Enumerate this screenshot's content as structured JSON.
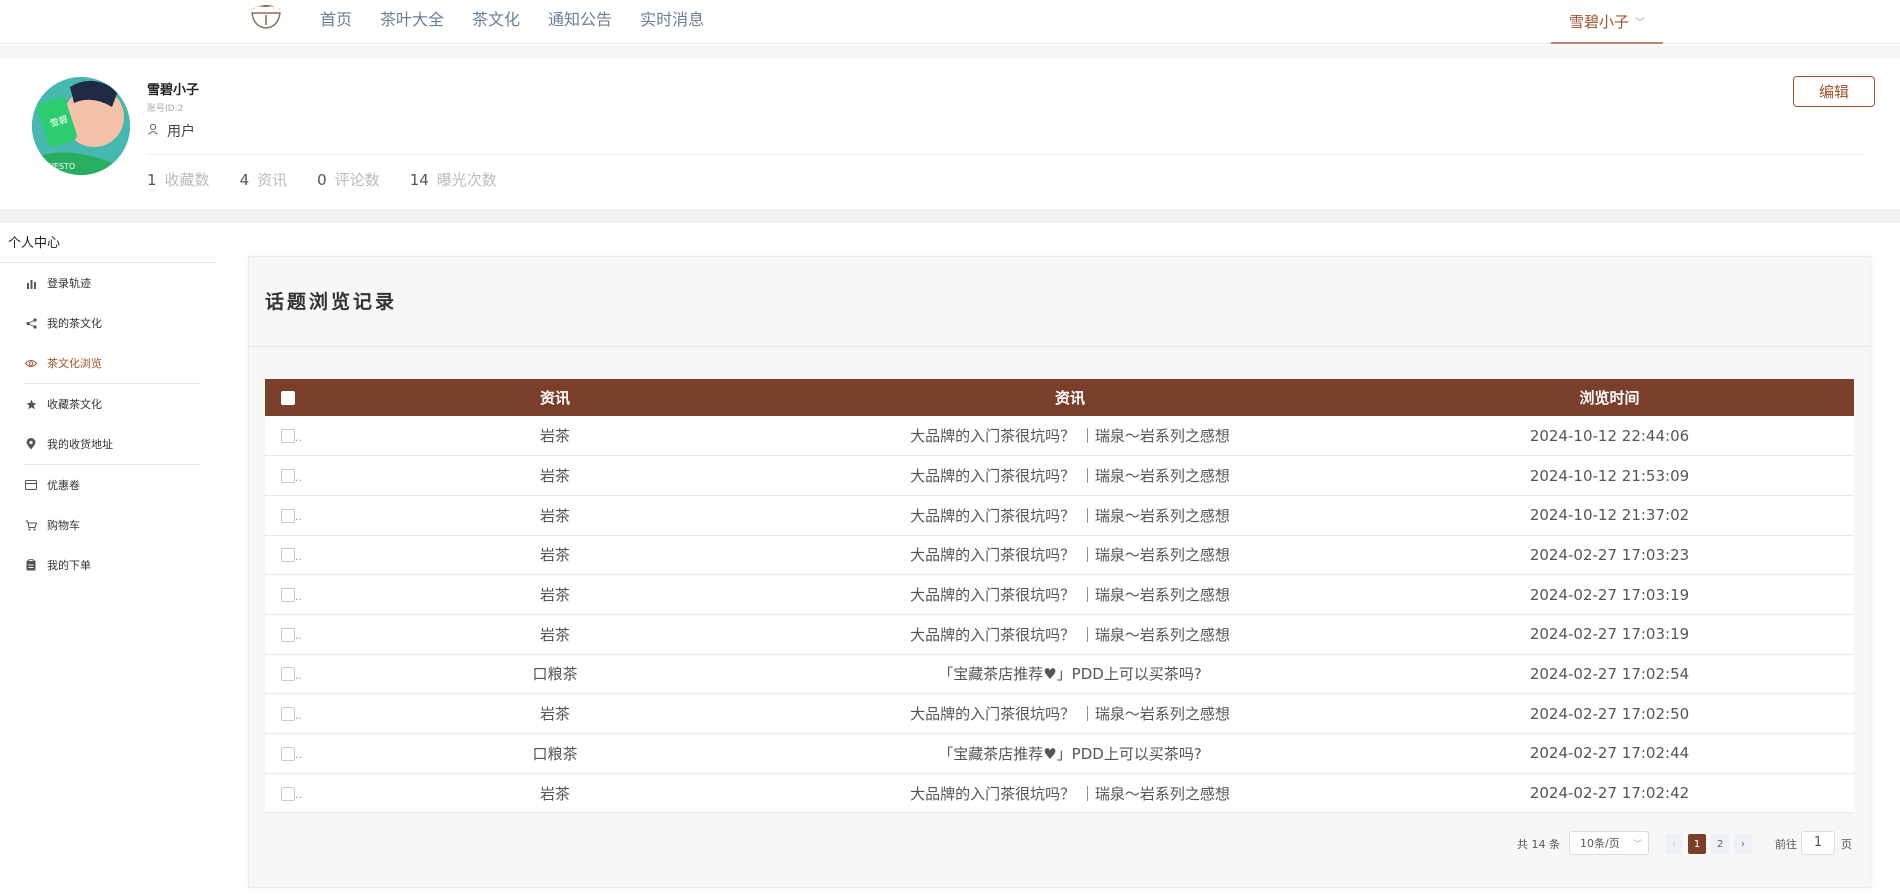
{
  "nav": {
    "items": [
      "首页",
      "茶叶大全",
      "茶文化",
      "通知公告",
      "实时消息"
    ],
    "user": "雪碧小子"
  },
  "profile": {
    "name": "雪碧小子",
    "id_text": "账号ID:2",
    "role": "用户",
    "edit_label": "编辑",
    "stats": [
      {
        "num": "1",
        "label": "收藏数"
      },
      {
        "num": "4",
        "label": "资讯"
      },
      {
        "num": "0",
        "label": "评论数"
      },
      {
        "num": "14",
        "label": "曝光次数"
      }
    ]
  },
  "sidebar": {
    "title": "个人中心",
    "items": [
      {
        "label": "登录轨迹",
        "icon": "bar-chart-icon",
        "active": false
      },
      {
        "label": "我的茶文化",
        "icon": "share-icon",
        "active": false
      },
      {
        "label": "茶文化浏览",
        "icon": "eye-icon",
        "active": true
      },
      {
        "label": "收藏茶文化",
        "icon": "star-icon",
        "active": false
      },
      {
        "label": "我的收货地址",
        "icon": "location-icon",
        "active": false
      },
      {
        "label": "优惠卷",
        "icon": "card-icon",
        "active": false
      },
      {
        "label": "购物车",
        "icon": "cart-icon",
        "active": false
      },
      {
        "label": "我的下单",
        "icon": "clipboard-icon",
        "active": false
      }
    ]
  },
  "card": {
    "title": "话题浏览记录",
    "columns": [
      "资讯",
      "资讯",
      "浏览时间"
    ],
    "rows": [
      {
        "category": "岩茶",
        "title": "大品牌的入门茶很坑吗？ ｜瑞泉～岩系列之感想",
        "time": "2024-10-12 22:44:06"
      },
      {
        "category": "岩茶",
        "title": "大品牌的入门茶很坑吗？ ｜瑞泉～岩系列之感想",
        "time": "2024-10-12 21:53:09"
      },
      {
        "category": "岩茶",
        "title": "大品牌的入门茶很坑吗？ ｜瑞泉～岩系列之感想",
        "time": "2024-10-12 21:37:02"
      },
      {
        "category": "岩茶",
        "title": "大品牌的入门茶很坑吗？ ｜瑞泉～岩系列之感想",
        "time": "2024-02-27 17:03:23"
      },
      {
        "category": "岩茶",
        "title": "大品牌的入门茶很坑吗？ ｜瑞泉～岩系列之感想",
        "time": "2024-02-27 17:03:19"
      },
      {
        "category": "岩茶",
        "title": "大品牌的入门茶很坑吗？ ｜瑞泉～岩系列之感想",
        "time": "2024-02-27 17:03:19"
      },
      {
        "category": "口粮茶",
        "title": "「宝藏茶店推荐♥」PDD上可以买茶吗?",
        "time": "2024-02-27 17:02:54"
      },
      {
        "category": "岩茶",
        "title": "大品牌的入门茶很坑吗？ ｜瑞泉～岩系列之感想",
        "time": "2024-02-27 17:02:50"
      },
      {
        "category": "口粮茶",
        "title": "「宝藏茶店推荐♥」PDD上可以买茶吗?",
        "time": "2024-02-27 17:02:44"
      },
      {
        "category": "岩茶",
        "title": "大品牌的入门茶很坑吗？ ｜瑞泉～岩系列之感想",
        "time": "2024-02-27 17:02:42"
      }
    ]
  },
  "pager": {
    "total": "共 14 条",
    "page_size": "10条/页",
    "pages": [
      "1",
      "2"
    ],
    "current": "1",
    "goto_label": "前往",
    "goto_value": "1",
    "page_suffix": "页"
  },
  "colors": {
    "accent": "#a0522d",
    "table_header": "#7a3f2a"
  }
}
